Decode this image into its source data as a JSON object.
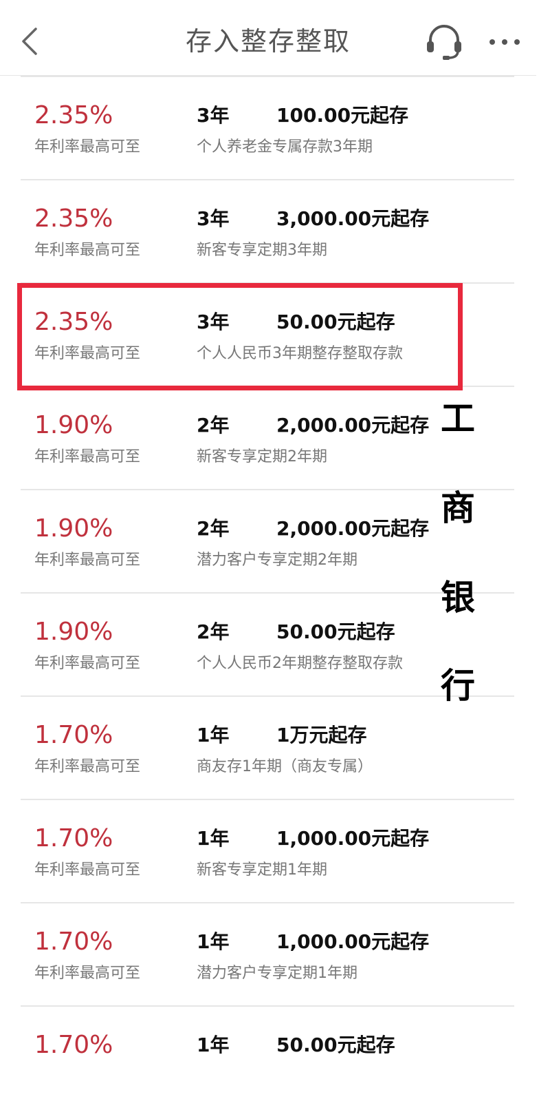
{
  "header": {
    "title": "存入整存整取",
    "back_icon": "chevron-left-icon",
    "service_icon": "headset-icon",
    "more_icon": "more-dots-icon"
  },
  "colors": {
    "rate": "#c0313d",
    "highlight": "#e8293d",
    "divider": "#e6e6e6"
  },
  "items": [
    {
      "rate": "2.35%",
      "rate_label": "年利率最高可至",
      "term": "3年",
      "min": "100.00元起存",
      "product": "个人养老金专属存款3年期"
    },
    {
      "rate": "2.35%",
      "rate_label": "年利率最高可至",
      "term": "3年",
      "min": "3,000.00元起存",
      "product": "新客专享定期3年期"
    },
    {
      "rate": "2.35%",
      "rate_label": "年利率最高可至",
      "term": "3年",
      "min": "50.00元起存",
      "product": "个人人民币3年期整存整取存款"
    },
    {
      "rate": "1.90%",
      "rate_label": "年利率最高可至",
      "term": "2年",
      "min": "2,000.00元起存",
      "product": "新客专享定期2年期"
    },
    {
      "rate": "1.90%",
      "rate_label": "年利率最高可至",
      "term": "2年",
      "min": "2,000.00元起存",
      "product": "潜力客户专享定期2年期"
    },
    {
      "rate": "1.90%",
      "rate_label": "年利率最高可至",
      "term": "2年",
      "min": "50.00元起存",
      "product": "个人人民币2年期整存整取存款"
    },
    {
      "rate": "1.70%",
      "rate_label": "年利率最高可至",
      "term": "1年",
      "min": "1万元起存",
      "product": "商友存1年期（商友专属）"
    },
    {
      "rate": "1.70%",
      "rate_label": "年利率最高可至",
      "term": "1年",
      "min": "1,000.00元起存",
      "product": "新客专享定期1年期"
    },
    {
      "rate": "1.70%",
      "rate_label": "年利率最高可至",
      "term": "1年",
      "min": "1,000.00元起存",
      "product": "潜力客户专享定期1年期"
    },
    {
      "rate": "1.70%",
      "rate_label": "",
      "term": "1年",
      "min": "50.00元起存",
      "product": ""
    }
  ],
  "watermark": {
    "chars": [
      "工",
      "商",
      "银",
      "行"
    ]
  }
}
